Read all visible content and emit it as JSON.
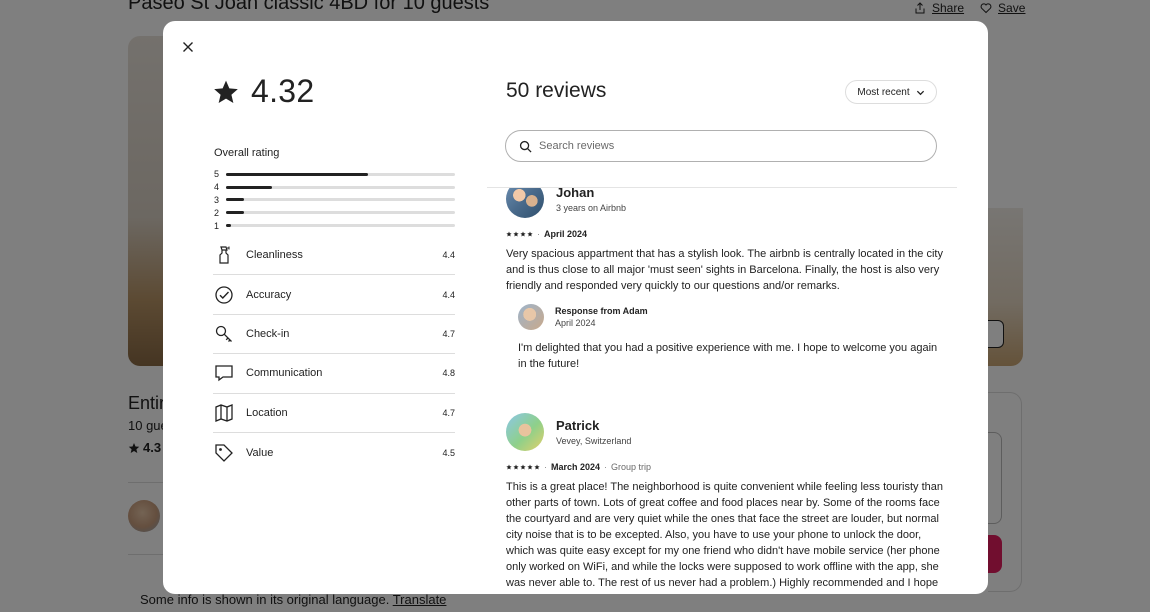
{
  "background": {
    "title": "Paseo St Joan classic 4BD for 10 guests",
    "share_label": "Share",
    "save_label": "Save",
    "entire_text": "Entir",
    "guests_text": "10 gue",
    "rating_text": "4.3",
    "footer_text": "Some info is shown in its original language.",
    "translate_label": "Translate"
  },
  "modal": {
    "overall_score": "4.32",
    "overall_label": "Overall rating",
    "distribution": [
      {
        "stars": "5",
        "fraction": 0.62
      },
      {
        "stars": "4",
        "fraction": 0.2
      },
      {
        "stars": "3",
        "fraction": 0.08
      },
      {
        "stars": "2",
        "fraction": 0.08
      },
      {
        "stars": "1",
        "fraction": 0.02
      }
    ],
    "categories": [
      {
        "label": "Cleanliness",
        "score": "4.4",
        "icon": "spray-bottle-icon"
      },
      {
        "label": "Accuracy",
        "score": "4.4",
        "icon": "check-circle-icon"
      },
      {
        "label": "Check-in",
        "score": "4.7",
        "icon": "key-icon"
      },
      {
        "label": "Communication",
        "score": "4.8",
        "icon": "message-bubble-icon"
      },
      {
        "label": "Location",
        "score": "4.7",
        "icon": "map-icon"
      },
      {
        "label": "Value",
        "score": "4.5",
        "icon": "price-tag-icon"
      }
    ],
    "reviews_count": "50 reviews",
    "sort_label": "Most recent",
    "search_placeholder": "Search reviews",
    "reviews": [
      {
        "name": "Johan",
        "subtitle": "3 years on Airbnb",
        "stars": 4,
        "date": "April 2024",
        "trip": "",
        "text": "Very spacious appartment that has a stylish look. The airbnb is centrally located in the city and is thus close to all major 'must seen' sights in Barcelona. Finally, the host is also very friendly and responded very quickly to our questions and/or remarks.",
        "response": {
          "title": "Response from Adam",
          "date": "April 2024",
          "text": "I'm delighted that you had a positive experience with me. I hope to welcome you again in the future!"
        }
      },
      {
        "name": "Patrick",
        "subtitle": "Vevey, Switzerland",
        "stars": 5,
        "date": "March 2024",
        "trip": "Group trip",
        "text": "This is a great place! The neighborhood is quite convenient while feeling less touristy than other parts of town. Lots of great coffee and food places near by. Some of the rooms face the courtyard and are very quiet while the ones that face the street are louder, but normal city noise that is to be excepted. Also, you have to use your phone to unlock the door, which was quite easy except for my one friend who didn't have mobile service (her phone only worked on WiFi, and while the locks were supposed to work offline with the app, she was never able to. The rest of us never had a problem.) Highly recommended and I hope to stay there again!"
      }
    ]
  }
}
